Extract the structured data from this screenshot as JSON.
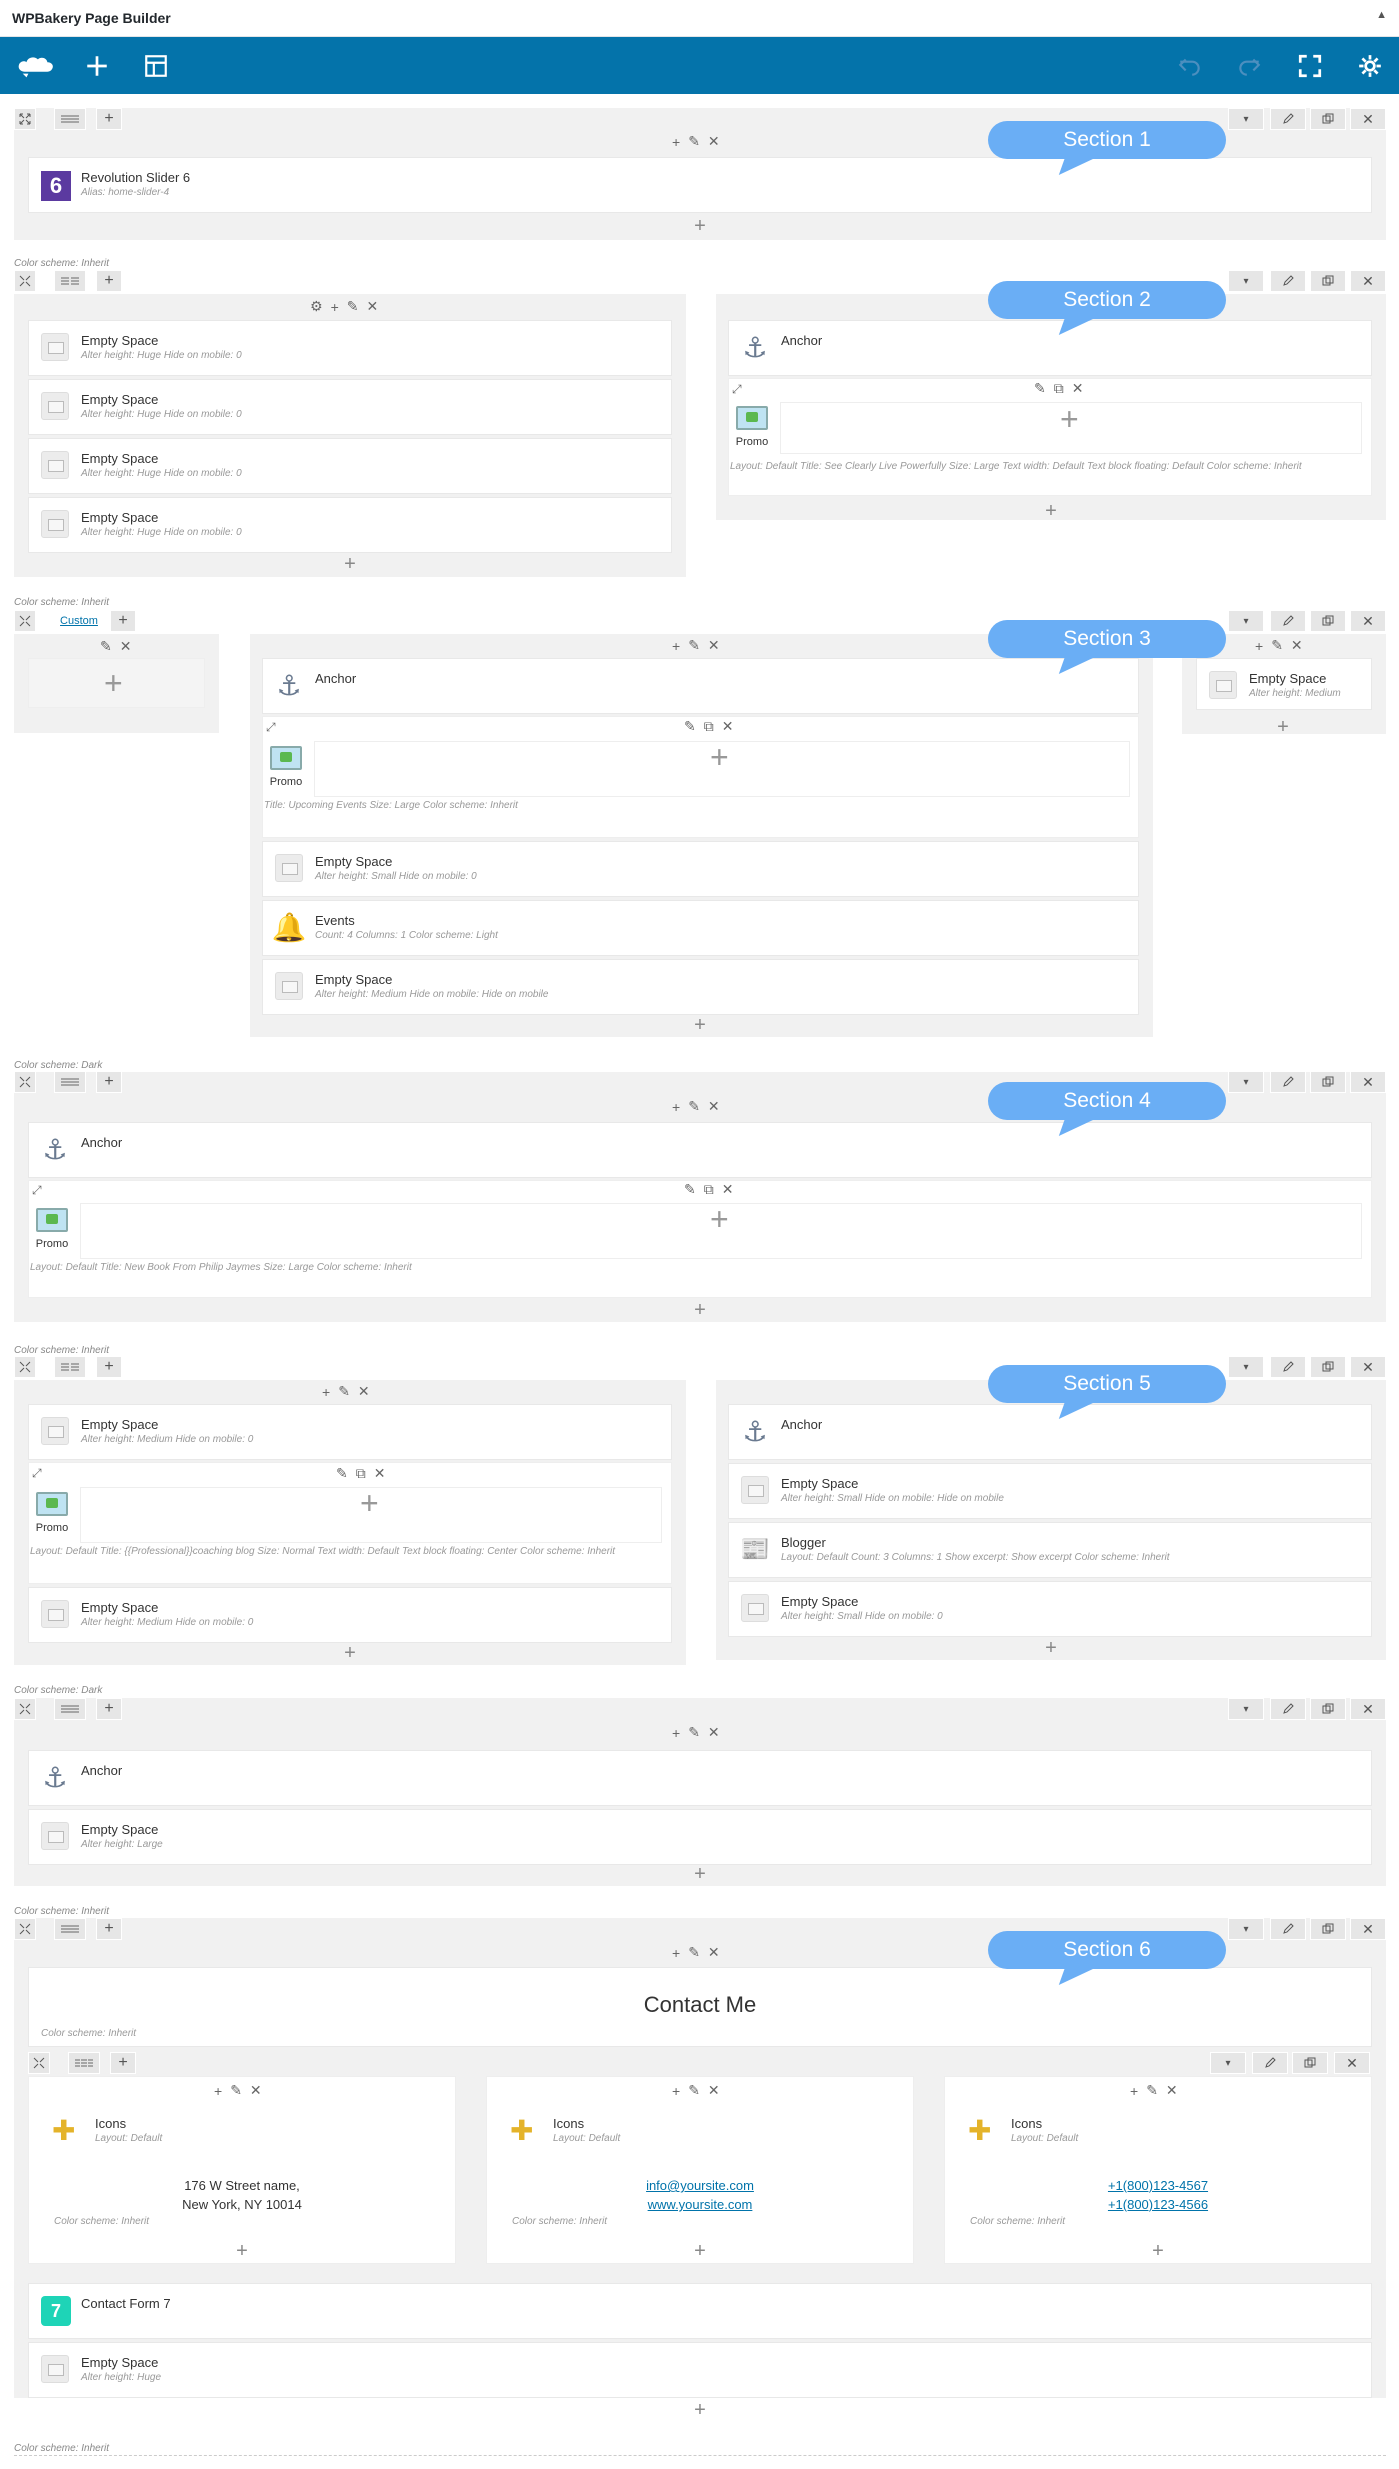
{
  "app": {
    "title": "WPBakery Page Builder"
  },
  "bubbles": [
    "Section 1",
    "Section 2",
    "Section 3",
    "Section 4",
    "Section 5",
    "Section 6"
  ],
  "rows": {
    "r1": {
      "slider_name": "Revolution Slider 6",
      "slider_desc": "Alias: home-slider-4",
      "slider_badge": "6"
    },
    "cs_inherit": "Color scheme: Inherit",
    "cs_dark": "Color scheme: Dark",
    "es_huge": "Alter height: Huge  Hide on mobile: 0",
    "empty_space": "Empty Space",
    "anchor": "Anchor",
    "promo": "Promo",
    "r2_promo_desc": "Layout: Default  Title: See Clearly Live Powerfully  Size: Large  Text width: Default  Text block floating: Default  Color scheme: Inherit",
    "custom_link": "Custom",
    "r3_promo_desc": "Title: Upcoming Events  Size: Large  Color scheme: Inherit",
    "es_small0": "Alter height: Small  Hide on mobile: 0",
    "events": "Events",
    "events_desc": "Count: 4  Columns: 1  Color scheme: Light",
    "es_medium_mob": "Alter height: Medium  Hide on mobile: Hide on mobile",
    "es_medium": "Alter height: Medium",
    "r4_promo_desc": "Layout: Default  Title: New Book From Philip Jaymes  Size: Large  Color scheme: Inherit",
    "es_medium0": "Alter height: Medium  Hide on mobile: 0",
    "r5_promo_desc": "Layout: Default  Title: {{Professional}}coaching blog  Size: Normal  Text width: Default  Text block floating: Center  Color scheme: Inherit",
    "es_small_mob": "Alter height: Small  Hide on mobile: Hide on mobile",
    "blogger": "Blogger",
    "blogger_desc": "Layout: Default  Count: 3  Columns: 1  Show excerpt: Show excerpt  Color scheme: Inherit",
    "es_large": "Alter height: Large",
    "contact_title": "Contact Me",
    "icons": "Icons",
    "layout_default": "Layout: Default",
    "address1": "176 W Street name,",
    "address2": "New York, NY 10014",
    "email": "info@yoursite.com",
    "website": "www.yoursite.com",
    "phone1": "+1(800)123-4567",
    "phone2": "+1(800)123-4566",
    "cf7": "Contact Form 7",
    "cf7_badge": "7",
    "es_huge_only": "Alter height: Huge"
  }
}
